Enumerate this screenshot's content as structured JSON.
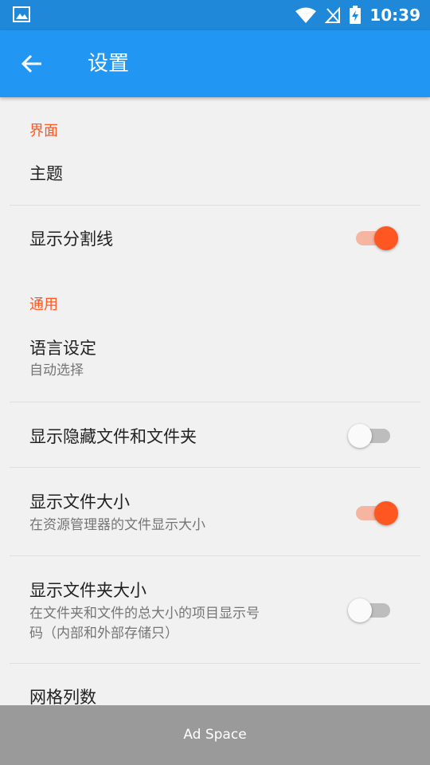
{
  "status_bar": {
    "time": "10:39"
  },
  "app_bar": {
    "title": "设置"
  },
  "sections": {
    "interface": {
      "header": "界面",
      "theme": {
        "title": "主题"
      },
      "show_divider": {
        "title": "显示分割线",
        "enabled": true
      }
    },
    "general": {
      "header": "通用",
      "language": {
        "title": "语言设定",
        "subtitle": "自动选择"
      },
      "show_hidden": {
        "title": "显示隐藏文件和文件夹",
        "enabled": false
      },
      "show_file_size": {
        "title": "显示文件大小",
        "subtitle": "在资源管理器的文件显示大小",
        "enabled": true
      },
      "show_folder_size": {
        "title": "显示文件夹大小",
        "subtitle_line1": "在文件夹和文件的总大小的项目显示号",
        "subtitle_line2": "码（内部和外部存储只）",
        "enabled": false
      },
      "grid_columns": {
        "title": "网格列数"
      }
    }
  },
  "ad": {
    "label": "Ad Space"
  },
  "colors": {
    "status_bar": "#1f88d8",
    "app_bar": "#2196f3",
    "accent": "#ff5722",
    "background": "#f1f1f1",
    "ad_banner": "#9a9a9a"
  },
  "icons": {
    "status_left": "image-icon",
    "wifi": "wifi-icon",
    "signal": "no-signal-icon",
    "battery": "battery-charging-icon",
    "back": "arrow-back-icon"
  }
}
